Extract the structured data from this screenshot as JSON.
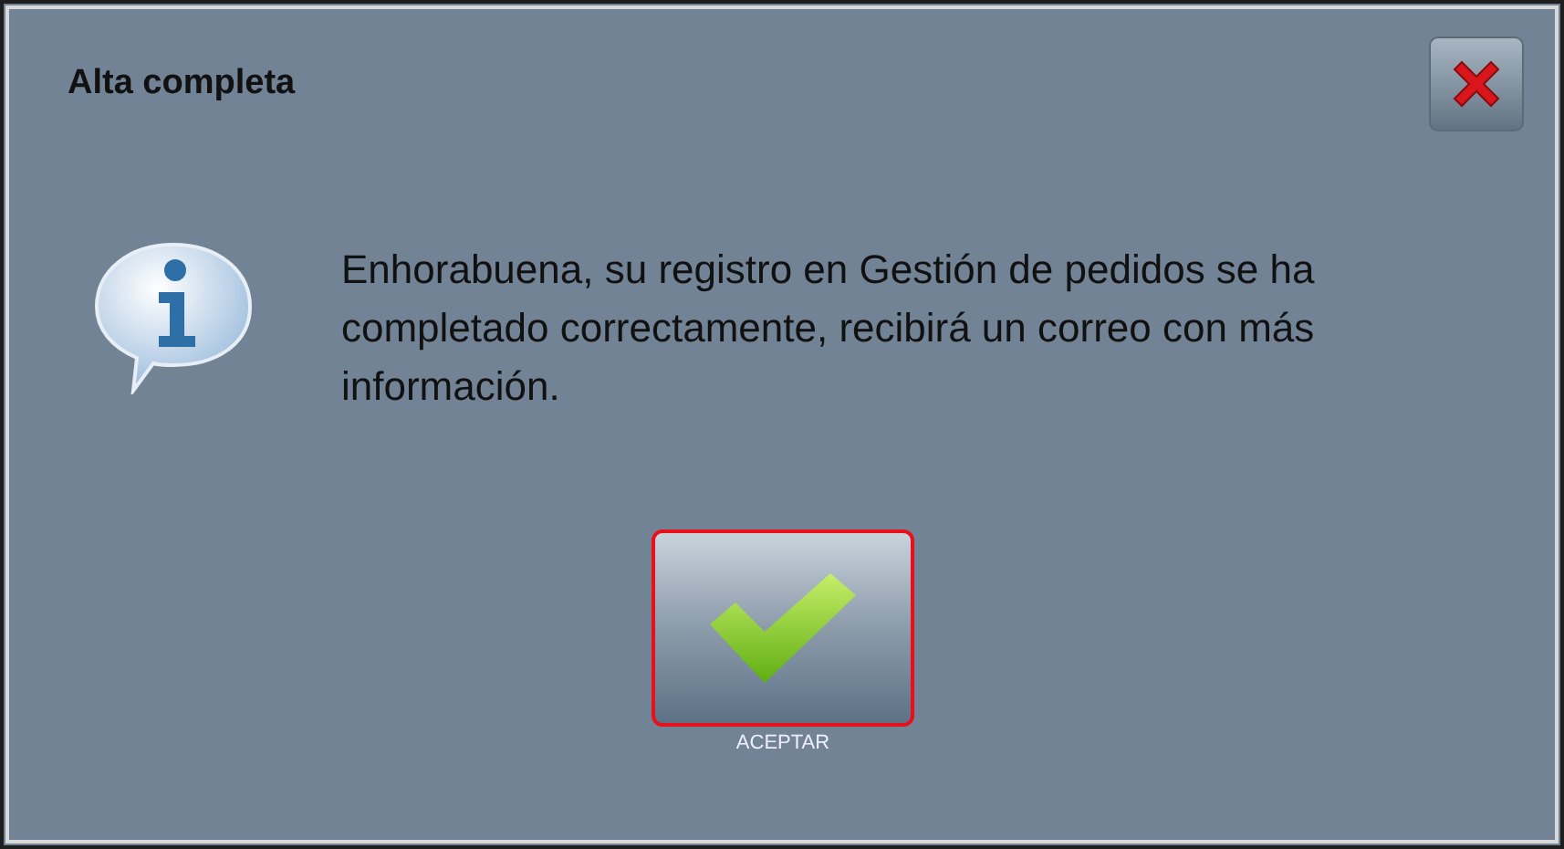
{
  "dialog": {
    "title": "Alta completa",
    "message": "Enhorabuena, su registro en Gestión de pedidos se ha completado correctamente, recibirá un correo con más información.",
    "button": {
      "label": "ACEPTAR",
      "focused": true
    }
  }
}
